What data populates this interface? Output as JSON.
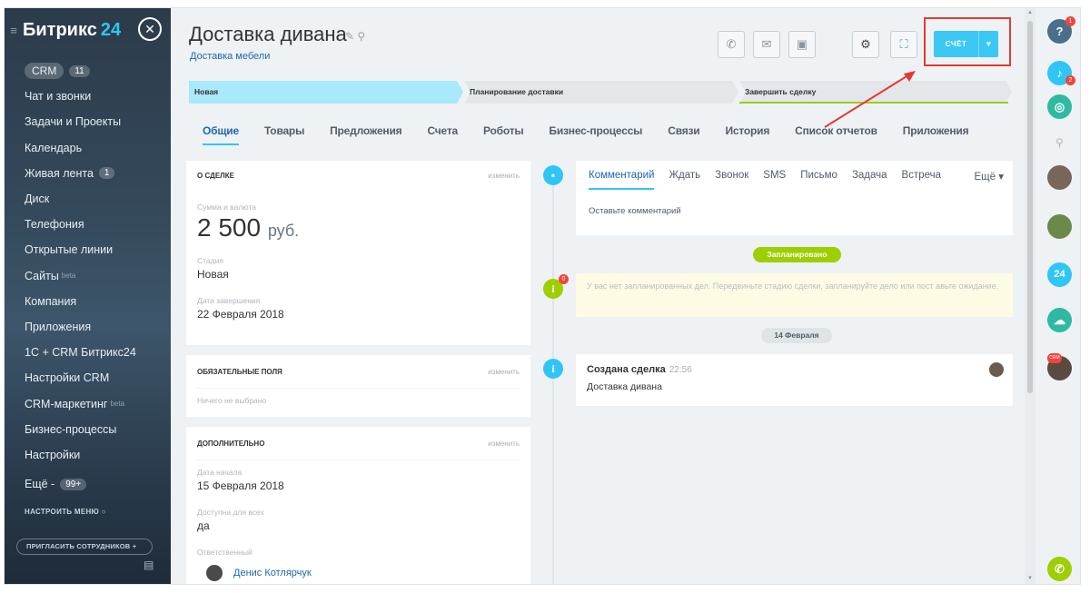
{
  "sidebar": {
    "logo": "Битрикс",
    "logo_num": "24",
    "crm_tag": "CRM",
    "crm_count": "11",
    "items": [
      {
        "label": "Чат и звонки"
      },
      {
        "label": "Задачи и Проекты"
      },
      {
        "label": "Календарь"
      },
      {
        "label": "Живая лента",
        "badge": "1"
      },
      {
        "label": "Диск"
      },
      {
        "label": "Телефония"
      },
      {
        "label": "Открытые линии"
      },
      {
        "label": "Сайты",
        "beta": "beta"
      },
      {
        "label": "Компания"
      },
      {
        "label": "Приложения"
      },
      {
        "label": "1С + CRM Битрикс24"
      },
      {
        "label": "Настройки CRM"
      },
      {
        "label": "CRM-маркетинг",
        "beta": "beta"
      },
      {
        "label": "Бизнес-процессы"
      },
      {
        "label": "Настройки"
      },
      {
        "label": "Ещё -",
        "badge": "99+"
      }
    ],
    "configure_menu": "НАСТРОИТЬ МЕНЮ",
    "invite": "ПРИГЛАСИТЬ СОТРУДНИКОВ"
  },
  "header": {
    "title": "Доставка дивана",
    "subtitle": "Доставка мебели",
    "invoice_label": "СЧЁТ"
  },
  "stages": [
    "Новая",
    "Планирование доставки",
    "Завершить сделку"
  ],
  "tabs": [
    "Общие",
    "Товары",
    "Предложения",
    "Счета",
    "Роботы",
    "Бизнес-процессы",
    "Связи",
    "История",
    "Список отчетов",
    "Приложения"
  ],
  "about_card": {
    "heading": "О СДЕЛКЕ",
    "edit": "изменить",
    "amount_label": "Сумма и валюта",
    "amount": "2 500",
    "currency": "руб.",
    "stage_label": "Стадия",
    "stage": "Новая",
    "close_label": "Дата завершения",
    "close_date": "22 Февраля 2018"
  },
  "required_card": {
    "heading": "ОБЯЗАТЕЛЬНЫЕ ПОЛЯ",
    "edit": "изменить",
    "empty": "Ничего не выбрано"
  },
  "extra_card": {
    "heading": "ДОПОЛНИТЕЛЬНО",
    "edit": "изменить",
    "start_label": "Дата начала",
    "start_date": "15 Февраля 2018",
    "available_label": "Доступна для всех",
    "available": "да",
    "responsible_label": "Ответственный",
    "responsible": "Денис Котлярчук"
  },
  "timeline": {
    "comment_tabs": [
      "Комментарий",
      "Ждать",
      "Звонок",
      "SMS",
      "Письмо",
      "Задача",
      "Встреча"
    ],
    "more": "Ещё",
    "comment_placeholder": "Оставьте комментарий",
    "planned": "Запланировано",
    "warning_badge": "0",
    "warning": "У вас нет запланированных дел. Передвиньте стадию сделки, запланируйте дело или пост авьте ожидание.",
    "date_pill": "14 Февраля",
    "event_title": "Создана сделка",
    "event_time": "22:56",
    "event_text": "Доставка дивана"
  },
  "right_panel": {
    "help_badge": "1",
    "bell_badge": "2",
    "b24_label": "24",
    "crm_label": "CRM"
  },
  "colors": {
    "accent": "#3bc8f5",
    "link": "#2067b0",
    "stage_active": "#a8e9fb",
    "planned": "#9dcf00",
    "highlight": "#e53935"
  }
}
